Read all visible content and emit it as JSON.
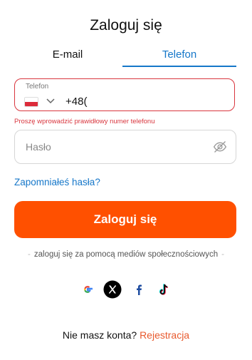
{
  "title": "Zaloguj się",
  "tabs": {
    "email": "E-mail",
    "phone": "Telefon",
    "active": "phone"
  },
  "phone": {
    "label": "Telefon",
    "value": "+48(",
    "country": "Poland"
  },
  "error": "Proszę wprowadzić prawidłowy numer telefonu",
  "password": {
    "placeholder": "Hasło"
  },
  "forgot": "Zapomniałeś hasła?",
  "login_button": "Zaloguj się",
  "social": {
    "text": "zaloguj się za pomocą mediów społecznościowych",
    "icons": [
      "google-icon",
      "x-icon",
      "facebook-icon",
      "tiktok-icon"
    ]
  },
  "bottom": {
    "question": "Nie masz konta?",
    "register": "Rejestracja"
  },
  "colors": {
    "accent": "#ff5000",
    "link": "#1677c9",
    "error": "#d9363e"
  }
}
